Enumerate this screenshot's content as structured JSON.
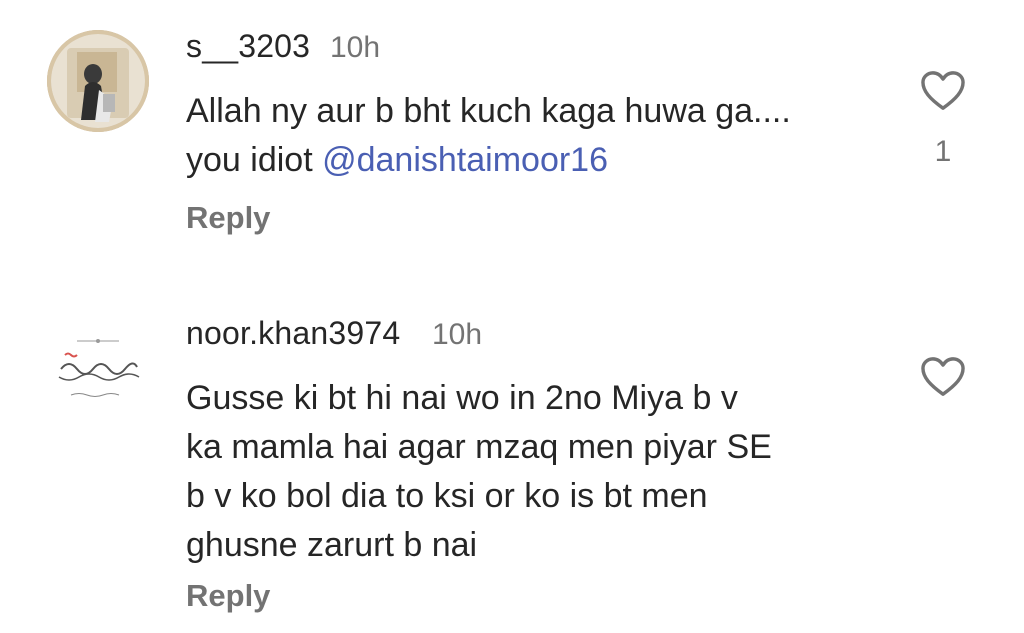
{
  "comments": [
    {
      "username": "s__3203",
      "time": "10h",
      "text": "Allah ny aur b bht kuch kaga huwa ga.... you idiot ",
      "mention": "@danishtaimoor16",
      "reply_label": "Reply",
      "like_count": "1"
    },
    {
      "username": "noor.khan3974",
      "time": "10h",
      "text_lines": [
        "Gusse ki bt hi nai wo in 2no Miya b v",
        "ka mamla hai agar mzaq men piyar SE",
        "b v ko bol dia to ksi or ko is bt men",
        "ghusne zarurt b nai"
      ],
      "reply_label": "Reply"
    }
  ]
}
